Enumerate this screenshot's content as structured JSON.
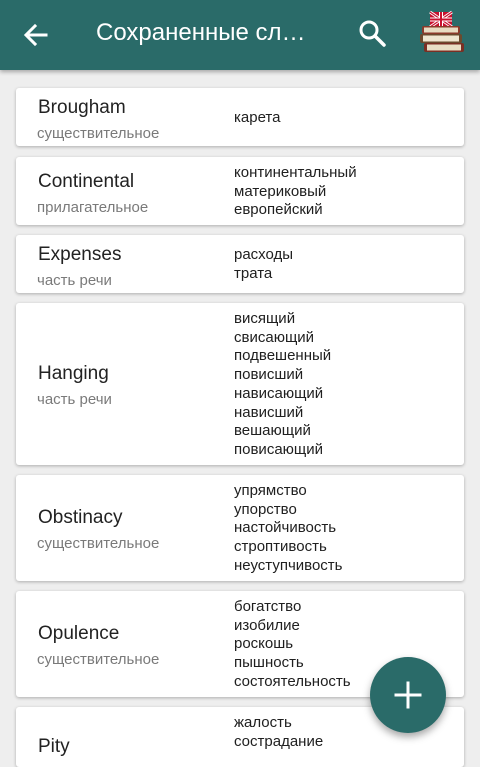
{
  "appbar": {
    "title": "Сохраненные сл…",
    "back_icon": "arrow-back-icon",
    "search_icon": "search-icon",
    "books_icon": "books-flag-icon"
  },
  "colors": {
    "primary": "#2a6b69",
    "background": "#eeeeee",
    "card": "#ffffff"
  },
  "entries": [
    {
      "word": "Brougham",
      "pos": "существительное",
      "translations": [
        "карета"
      ]
    },
    {
      "word": "Continental",
      "pos": "прилагательное",
      "translations": [
        "континентальный",
        "материковый",
        "европейский"
      ]
    },
    {
      "word": "Expenses",
      "pos": "часть речи",
      "translations": [
        "расходы",
        "трата"
      ]
    },
    {
      "word": "Hanging",
      "pos": "часть речи",
      "translations": [
        "висящий",
        "свисающий",
        "подвешенный",
        "повисший",
        "нависающий",
        "нависший",
        "вешающий",
        "повисающий"
      ]
    },
    {
      "word": "Obstinacy",
      "pos": "существительное",
      "translations": [
        "упрямство",
        "упорство",
        "настойчивость",
        "строптивость",
        "неуступчивость"
      ]
    },
    {
      "word": "Opulence",
      "pos": "существительное",
      "translations": [
        "богатство",
        "изобилие",
        "роскошь",
        "пышность",
        "состоятельность"
      ]
    },
    {
      "word": "Pity",
      "pos": "",
      "translations": [
        "жалость",
        "сострадание"
      ]
    }
  ],
  "fab": {
    "icon": "plus-icon"
  }
}
